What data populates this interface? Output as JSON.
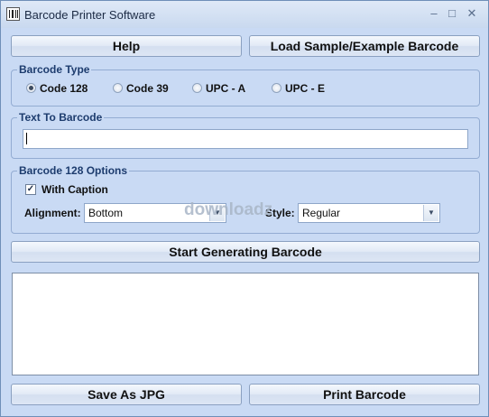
{
  "window": {
    "title": "Barcode Printer Software",
    "minimize": "–",
    "maximize": "□",
    "close": "✕"
  },
  "buttons": {
    "help": "Help",
    "load_sample": "Load Sample/Example Barcode",
    "start": "Start Generating Barcode",
    "save": "Save As JPG",
    "print": "Print Barcode"
  },
  "barcode_type": {
    "legend": "Barcode Type",
    "options": [
      {
        "label": "Code 128",
        "selected": true
      },
      {
        "label": "Code 39",
        "selected": false
      },
      {
        "label": "UPC - A",
        "selected": false
      },
      {
        "label": "UPC - E",
        "selected": false
      }
    ]
  },
  "text_to_barcode": {
    "legend": "Text To Barcode",
    "value": ""
  },
  "options": {
    "legend": "Barcode 128 Options",
    "with_caption_label": "With Caption",
    "with_caption_checked": true,
    "alignment_label": "Alignment:",
    "alignment_value": "Bottom",
    "style_label": "Style:",
    "style_value": "Regular"
  },
  "watermark": "downloadz"
}
